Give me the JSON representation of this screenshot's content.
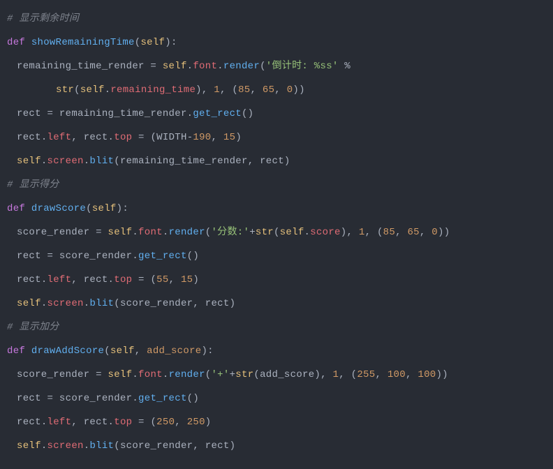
{
  "lines": {
    "l1_comment": "# 显示剩余时间",
    "l2_def": "def",
    "l2_fname": "showRemainingTime",
    "l2_self": "self",
    "l3_var": "remaining_time_render",
    "l3_assign": " = ",
    "l3_self": "self",
    "l3_dot1": ".",
    "l3_font": "font",
    "l3_dot2": ".",
    "l3_render": "render",
    "l3_str1": "'倒计时: %ss'",
    "l3_mod": " %",
    "l4_str": "str",
    "l4_self": "self",
    "l4_dot": ".",
    "l4_remaining": "remaining_time",
    "l4_num1": "1",
    "l4_num85": "85",
    "l4_num65": "65",
    "l4_num0": "0",
    "l5_rect": "rect",
    "l5_assign": " = ",
    "l5_var": "remaining_time_render",
    "l5_dot": ".",
    "l5_getrect": "get_rect",
    "l6_rect1": "rect",
    "l6_left": "left",
    "l6_rect2": "rect",
    "l6_top": "top",
    "l6_assign": " = ",
    "l6_width": "WIDTH",
    "l6_num190": "190",
    "l6_num15": "15",
    "l7_self": "self",
    "l7_screen": "screen",
    "l7_blit": "blit",
    "l7_arg": "remaining_time_render",
    "l7_rect": "rect",
    "l8_comment": "# 显示得分",
    "l9_def": "def",
    "l9_fname": "drawScore",
    "l9_self": "self",
    "l10_var": "score_render",
    "l10_self": "self",
    "l10_font": "font",
    "l10_render": "render",
    "l10_str": "'分数:'",
    "l10_plus": "+",
    "l10_strf": "str",
    "l10_self2": "self",
    "l10_score": "score",
    "l10_num1": "1",
    "l10_num85": "85",
    "l10_num65": "65",
    "l10_num0": "0",
    "l11_rect": "rect",
    "l11_var": "score_render",
    "l11_getrect": "get_rect",
    "l12_rect1": "rect",
    "l12_left": "left",
    "l12_rect2": "rect",
    "l12_top": "top",
    "l12_num55": "55",
    "l12_num15": "15",
    "l13_self": "self",
    "l13_screen": "screen",
    "l13_blit": "blit",
    "l13_arg": "score_render",
    "l13_rect": "rect",
    "l14_comment": "# 显示加分",
    "l15_def": "def",
    "l15_fname": "drawAddScore",
    "l15_self": "self",
    "l15_param": "add_score",
    "l16_var": "score_render",
    "l16_self": "self",
    "l16_font": "font",
    "l16_render": "render",
    "l16_str": "'+'",
    "l16_plus": "+",
    "l16_strf": "str",
    "l16_arg": "add_score",
    "l16_num1": "1",
    "l16_num255": "255",
    "l16_num100a": "100",
    "l16_num100b": "100",
    "l17_rect": "rect",
    "l17_var": "score_render",
    "l17_getrect": "get_rect",
    "l18_rect1": "rect",
    "l18_left": "left",
    "l18_rect2": "rect",
    "l18_top": "top",
    "l18_num250a": "250",
    "l18_num250b": "250",
    "l19_self": "self",
    "l19_screen": "screen",
    "l19_blit": "blit",
    "l19_arg": "score_render",
    "l19_rect": "rect"
  }
}
